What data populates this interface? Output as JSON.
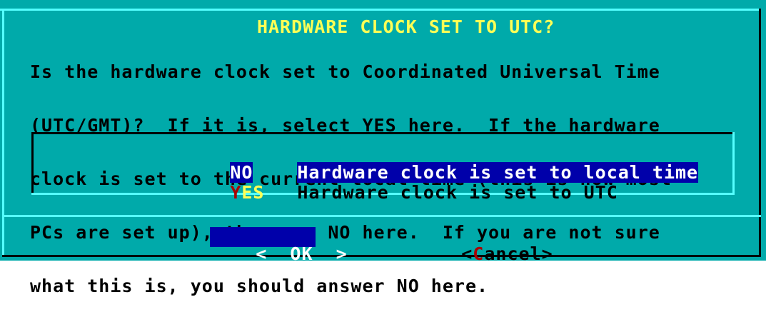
{
  "dialog": {
    "title": "HARDWARE CLOCK SET TO UTC?",
    "lines": [
      "Is the hardware clock set to Coordinated Universal Time",
      "(UTC/GMT)?  If it is, select YES here.  If the hardware",
      "clock is set to the current local time (this is how most",
      "PCs are set up), then say NO here.  If you are not sure",
      "what this is, you should answer NO here."
    ]
  },
  "menu": {
    "items": [
      {
        "tag_hot": "N",
        "tag_rest": "O",
        "description": "Hardware clock is set to local time",
        "selected": true
      },
      {
        "tag_hot": "Y",
        "tag_rest": "ES",
        "description": "Hardware clock is set to UTC",
        "selected": false
      }
    ]
  },
  "buttons": {
    "ok": {
      "left": "<",
      "label": "OK",
      "right": ">"
    },
    "cancel": {
      "left": "<",
      "hot": "C",
      "rest": "ancel",
      "right": ">"
    }
  },
  "colors": {
    "background": "#00aaaa",
    "title": "#ffff55",
    "selection": "#0000aa",
    "hotkey_selected": "#ff5555",
    "hotkey": "#ffff55",
    "cancel_hotkey": "#aa0000"
  }
}
